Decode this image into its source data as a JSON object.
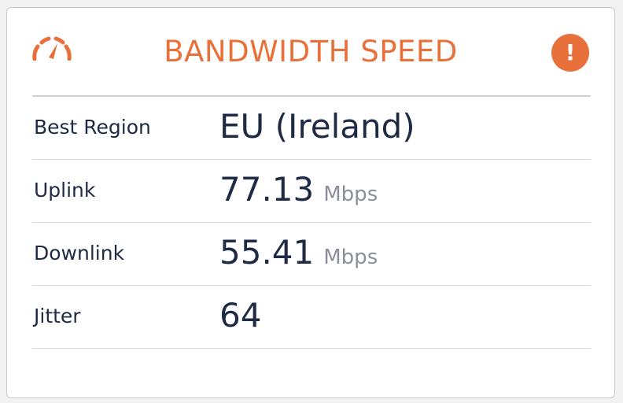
{
  "widget": {
    "title": "BANDWIDTH SPEED",
    "header_icon": "speedometer-icon",
    "alert_icon": "exclamation-icon",
    "alert_symbol": "!",
    "accent_color": "#e8703a",
    "text_color": "#1f2a44",
    "unit_color": "#8a8f99"
  },
  "rows": [
    {
      "label": "Best Region",
      "value": "EU (Ireland)",
      "unit": ""
    },
    {
      "label": "Uplink",
      "value": "77.13",
      "unit": "Mbps"
    },
    {
      "label": "Downlink",
      "value": "55.41",
      "unit": "Mbps"
    },
    {
      "label": "Jitter",
      "value": "64",
      "unit": ""
    }
  ]
}
